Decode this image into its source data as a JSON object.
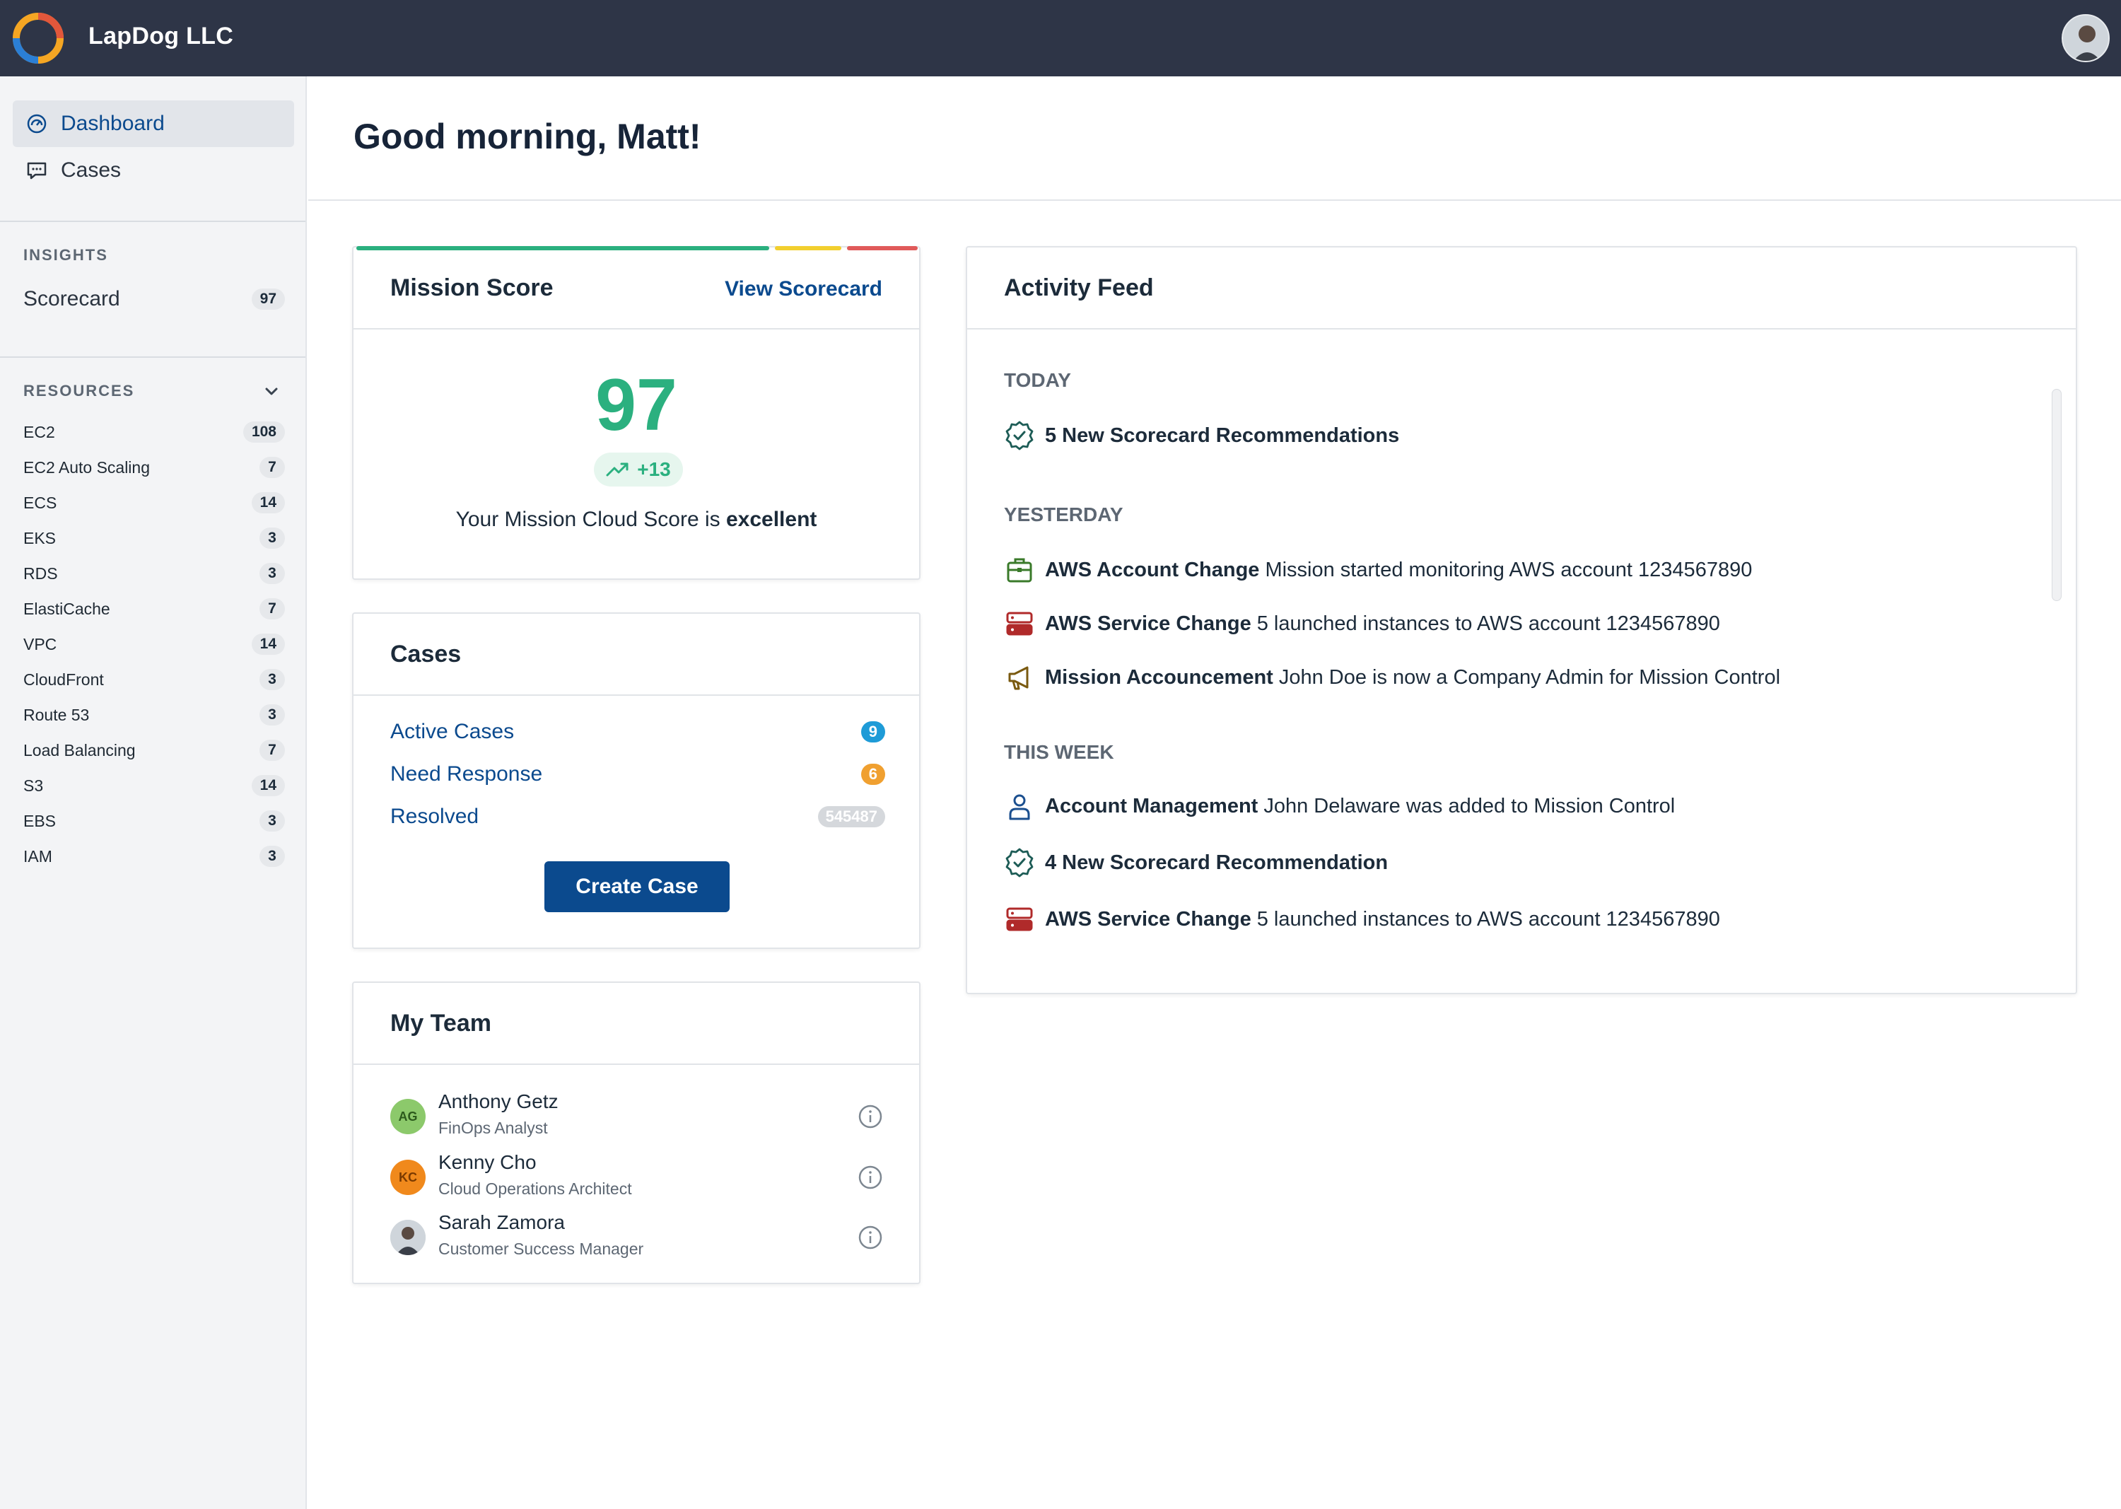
{
  "app": {
    "company": "LapDog LLC"
  },
  "sidebar": {
    "nav": [
      {
        "label": "Dashboard",
        "icon": "dashboard-icon"
      },
      {
        "label": "Cases",
        "icon": "chat-icon"
      }
    ],
    "insights_title": "INSIGHTS",
    "scorecard": {
      "label": "Scorecard",
      "count": "97"
    },
    "resources_title": "RESOURCES",
    "resources": [
      {
        "label": "EC2",
        "count": "108"
      },
      {
        "label": "EC2 Auto Scaling",
        "count": "7"
      },
      {
        "label": "ECS",
        "count": "14"
      },
      {
        "label": "EKS",
        "count": "3"
      },
      {
        "label": "RDS",
        "count": "3"
      },
      {
        "label": "ElastiCache",
        "count": "7"
      },
      {
        "label": "VPC",
        "count": "14"
      },
      {
        "label": "CloudFront",
        "count": "3"
      },
      {
        "label": "Route 53",
        "count": "3"
      },
      {
        "label": "Load Balancing",
        "count": "7"
      },
      {
        "label": "S3",
        "count": "14"
      },
      {
        "label": "EBS",
        "count": "3"
      },
      {
        "label": "IAM",
        "count": "3"
      }
    ]
  },
  "main": {
    "greeting": "Good morning, Matt!"
  },
  "mission": {
    "title": "Mission Score",
    "link": "View Scorecard",
    "score": "97",
    "delta": "+13",
    "text_prefix": "Your Mission Cloud Score is ",
    "text_rating": "excellent",
    "colors": {
      "good": "#2bb07f",
      "warn": "#f2cf2e",
      "bad": "#e05a5a"
    }
  },
  "cases": {
    "title": "Cases",
    "rows": [
      {
        "label": "Active Cases",
        "count": "9",
        "color": "#1e9bd7"
      },
      {
        "label": "Need Response",
        "count": "6",
        "color": "#f0a030"
      },
      {
        "label": "Resolved",
        "count": "545487",
        "color": "#d5d8dc"
      }
    ],
    "button": "Create Case"
  },
  "team": {
    "title": "My Team",
    "members": [
      {
        "initials": "AG",
        "name": "Anthony Getz",
        "role": "FinOps Analyst"
      },
      {
        "initials": "KC",
        "name": "Kenny Cho",
        "role": "Cloud Operations Architect"
      },
      {
        "initials": "",
        "name": "Sarah Zamora",
        "role": "Customer Success Manager"
      }
    ]
  },
  "feed": {
    "title": "Activity Feed",
    "groups": [
      {
        "title": "TODAY",
        "items": [
          {
            "icon": "check-badge-icon",
            "bold": "5 New Scorecard Recommendations",
            "text": ""
          }
        ]
      },
      {
        "title": "YESTERDAY",
        "items": [
          {
            "icon": "briefcase-icon",
            "bold": "AWS Account Change",
            "text": "Mission started monitoring AWS account 1234567890"
          },
          {
            "icon": "server-icon",
            "bold": "AWS Service Change",
            "text": "5 launched instances to AWS account 1234567890"
          },
          {
            "icon": "megaphone-icon",
            "bold": "Mission Accouncement",
            "text": "John Doe is now a Company Admin for Mission Control"
          }
        ]
      },
      {
        "title": "THIS WEEK",
        "items": [
          {
            "icon": "user-icon",
            "bold": "Account Management",
            "text": "John Delaware was added to Mission Control"
          },
          {
            "icon": "check-badge-icon",
            "bold": "4 New Scorecard Recommendation",
            "text": ""
          },
          {
            "icon": "server-icon",
            "bold": "AWS Service Change",
            "text": "5 launched instances to AWS account 1234567890"
          }
        ]
      }
    ]
  }
}
